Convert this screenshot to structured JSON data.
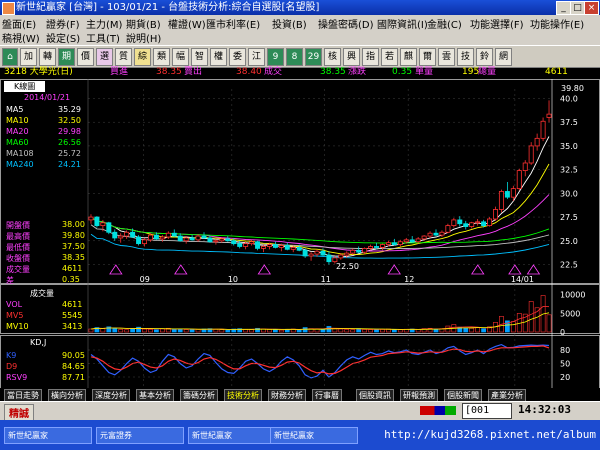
{
  "window": {
    "title": "新世紀贏家 [台灣] - 103/01/21 - 台盤技術分析:綜合自選股[名望股]",
    "min": "_",
    "max": "□",
    "close": "×"
  },
  "menu": {
    "row1": [
      "盤面(E)",
      "證券(F)",
      "主力(M)",
      "期貨(B)",
      "權證(W)",
      "匯市利率(E)",
      "投資(B)",
      "操盤密碼(D)",
      "國際資訊(I)",
      "金融(C)",
      "功能選擇(F)",
      "功能操作(E)"
    ],
    "row2": [
      "稿視(W)",
      "設定(S)",
      "工具(T)",
      "說明(H)"
    ]
  },
  "toolbar": {
    "buttons": [
      "加",
      "轉",
      "期",
      "價",
      "選",
      "質",
      "綜",
      "類",
      "幅",
      "智",
      "權",
      "委",
      "江",
      "9",
      "8",
      "29",
      "核",
      "興",
      "指",
      "若",
      "麒",
      "爾",
      "雲",
      "技",
      "鈴",
      "網"
    ]
  },
  "quote": {
    "symbol": "3218 大學光(日)",
    "bid_label": "買進",
    "bid": "38.35",
    "ask_label": "賣出",
    "ask": "38.40",
    "last_label": "成交",
    "last": "38.35",
    "change_label": "漲跌",
    "change": "0.35",
    "volume_label": "單量",
    "volume": "195",
    "total_label": "總量",
    "total": "4611"
  },
  "colors": {
    "up": "#ff3030",
    "down": "#00e0e0",
    "ma5": "#ffffff",
    "ma10": "#ffff00",
    "ma20": "#ff40ff",
    "ma60": "#00ff00",
    "ma108": "#c0c0c0",
    "ma240": "#00c0ff",
    "vol": "#00a0ff",
    "k9": "#3060ff",
    "d9": "#ff3030",
    "grid": "#404040"
  },
  "kpanel": {
    "label": "K線圖",
    "date": "2014/01/21",
    "legend": [
      {
        "name": "MA5",
        "value": "35.29",
        "color": "#ffffff"
      },
      {
        "name": "MA10",
        "value": "32.50",
        "color": "#ffff00"
      },
      {
        "name": "MA20",
        "value": "29.98",
        "color": "#ff40ff"
      },
      {
        "name": "MA60",
        "value": "26.56",
        "color": "#00ff00"
      },
      {
        "name": "MA108",
        "value": "25.72",
        "color": "#c0c0c0"
      },
      {
        "name": "MA240",
        "value": "24.21",
        "color": "#00c0ff"
      }
    ],
    "ohlc": [
      {
        "label": "開盤價",
        "value": "38.00"
      },
      {
        "label": "最高價",
        "value": "39.80"
      },
      {
        "label": "最低價",
        "value": "37.50"
      },
      {
        "label": "收盤價",
        "value": "38.35"
      },
      {
        "label": "成交量",
        "value": "4611"
      },
      {
        "label": "差",
        "value": "0.35"
      }
    ],
    "high_marker": "39.80",
    "low_marker": "22.50",
    "yticks": [
      "40.0",
      "37.5",
      "35.0",
      "32.5",
      "30.0",
      "27.5",
      "25.0",
      "22.5"
    ],
    "xticks": [
      "09",
      "10",
      "11",
      "12",
      "14/01"
    ]
  },
  "volpanel": {
    "label": "成交量",
    "legend": [
      {
        "name": "VOL",
        "value": "4611",
        "color": "#ff40ff"
      },
      {
        "name": "MV5",
        "value": "5545",
        "color": "#ff3030"
      },
      {
        "name": "MV10",
        "value": "3413",
        "color": "#ffff00"
      }
    ],
    "yticks": [
      "10000",
      "5000",
      "0"
    ]
  },
  "kdpanel": {
    "label": "KD,J",
    "legend": [
      {
        "name": "K9",
        "value": "90.05",
        "color": "#3060ff"
      },
      {
        "name": "D9",
        "value": "84.65",
        "color": "#ff3030"
      },
      {
        "name": "RSV9",
        "value": "87.71",
        "color": "#ff40ff"
      }
    ],
    "yticks": [
      "80",
      "50",
      "20"
    ]
  },
  "tabs": [
    "當日走勢",
    "橫向分析",
    "深度分析",
    "基本分析",
    "籌碼分析",
    "技術分析",
    "財務分析",
    "行事曆",
    "個股資訊",
    "研報預測",
    "個股新聞",
    "產業分析"
  ],
  "active_tab": "技術分析",
  "status": {
    "mode": "精誠",
    "input": "001",
    "time": "14:32:03"
  },
  "taskbar": {
    "tasks": [
      "新世紀贏家",
      "元富證券",
      "新世紀贏家",
      "新世紀贏家"
    ],
    "url": "http://kujd3268.pixnet.net/album"
  },
  "chart_data": {
    "type": "candlestick",
    "title": "3218 大學光(日)",
    "ylim": [
      21.5,
      41
    ],
    "xticks": [
      "09",
      "10",
      "11",
      "12",
      "14/01"
    ],
    "candles": [
      [
        27.2,
        27.8,
        26.8,
        27.5
      ],
      [
        27.5,
        27.6,
        26.4,
        26.6
      ],
      [
        26.6,
        27.2,
        26.0,
        26.9
      ],
      [
        26.9,
        27.0,
        25.7,
        25.9
      ],
      [
        25.9,
        26.2,
        25.0,
        25.3
      ],
      [
        25.3,
        25.8,
        24.8,
        25.5
      ],
      [
        25.5,
        26.1,
        25.2,
        25.9
      ],
      [
        25.9,
        26.3,
        25.3,
        25.4
      ],
      [
        25.4,
        25.6,
        24.5,
        24.7
      ],
      [
        24.7,
        25.3,
        24.4,
        25.1
      ],
      [
        25.1,
        25.8,
        24.9,
        25.6
      ],
      [
        25.6,
        25.9,
        25.1,
        25.2
      ],
      [
        25.2,
        25.6,
        24.9,
        25.4
      ],
      [
        25.4,
        26.0,
        25.2,
        25.8
      ],
      [
        25.8,
        26.2,
        25.4,
        25.5
      ],
      [
        25.5,
        25.8,
        24.9,
        25.0
      ],
      [
        25.0,
        25.5,
        24.7,
        25.3
      ],
      [
        25.3,
        25.6,
        25.0,
        25.1
      ],
      [
        25.1,
        25.7,
        24.9,
        25.5
      ],
      [
        25.5,
        25.9,
        25.2,
        25.3
      ],
      [
        25.3,
        25.5,
        24.8,
        24.9
      ],
      [
        24.9,
        25.2,
        24.6,
        25.0
      ],
      [
        25.0,
        25.4,
        24.8,
        25.2
      ],
      [
        25.2,
        25.5,
        24.9,
        25.0
      ],
      [
        25.0,
        25.3,
        24.5,
        24.7
      ],
      [
        24.7,
        25.0,
        24.2,
        24.4
      ],
      [
        24.4,
        24.9,
        24.1,
        24.7
      ],
      [
        24.7,
        25.1,
        24.5,
        24.9
      ],
      [
        24.9,
        25.0,
        24.0,
        24.2
      ],
      [
        24.2,
        24.6,
        23.8,
        24.4
      ],
      [
        24.4,
        24.8,
        24.1,
        24.6
      ],
      [
        24.6,
        24.9,
        24.2,
        24.3
      ],
      [
        24.3,
        24.7,
        23.9,
        24.5
      ],
      [
        24.5,
        24.8,
        24.0,
        24.1
      ],
      [
        24.1,
        24.5,
        23.8,
        24.3
      ],
      [
        24.3,
        24.6,
        23.9,
        24.0
      ],
      [
        24.0,
        24.2,
        23.2,
        23.4
      ],
      [
        23.4,
        23.8,
        22.9,
        23.6
      ],
      [
        23.6,
        24.1,
        23.3,
        23.9
      ],
      [
        23.9,
        24.2,
        23.4,
        23.5
      ],
      [
        23.5,
        23.9,
        22.5,
        22.8
      ],
      [
        22.8,
        23.4,
        22.6,
        23.2
      ],
      [
        23.2,
        23.7,
        23.0,
        23.5
      ],
      [
        23.5,
        23.9,
        23.2,
        23.7
      ],
      [
        23.7,
        24.2,
        23.5,
        24.0
      ],
      [
        24.0,
        24.4,
        23.7,
        23.8
      ],
      [
        23.8,
        24.3,
        23.6,
        24.2
      ],
      [
        24.2,
        24.6,
        24.0,
        24.4
      ],
      [
        24.4,
        24.8,
        24.1,
        24.3
      ],
      [
        24.3,
        24.7,
        24.0,
        24.6
      ],
      [
        24.6,
        25.0,
        24.4,
        24.8
      ],
      [
        24.8,
        25.2,
        24.5,
        24.6
      ],
      [
        24.6,
        25.1,
        24.4,
        24.9
      ],
      [
        24.9,
        25.3,
        24.7,
        25.1
      ],
      [
        25.1,
        25.5,
        24.8,
        24.9
      ],
      [
        24.9,
        25.4,
        24.7,
        25.2
      ],
      [
        25.2,
        25.6,
        25.0,
        25.5
      ],
      [
        25.5,
        26.0,
        25.3,
        25.8
      ],
      [
        25.8,
        26.2,
        25.5,
        25.6
      ],
      [
        25.6,
        26.1,
        25.4,
        25.9
      ],
      [
        25.9,
        26.8,
        25.8,
        26.6
      ],
      [
        26.6,
        27.4,
        26.4,
        27.2
      ],
      [
        27.2,
        27.6,
        26.5,
        26.8
      ],
      [
        26.8,
        27.1,
        26.2,
        26.5
      ],
      [
        26.5,
        27.0,
        26.3,
        26.9
      ],
      [
        26.9,
        27.3,
        26.6,
        27.0
      ],
      [
        27.0,
        27.2,
        26.4,
        26.6
      ],
      [
        26.6,
        27.5,
        26.5,
        27.3
      ],
      [
        27.3,
        28.6,
        27.1,
        28.3
      ],
      [
        28.3,
        30.4,
        28.0,
        30.2
      ],
      [
        30.2,
        31.2,
        29.4,
        29.6
      ],
      [
        29.6,
        30.8,
        29.2,
        30.5
      ],
      [
        30.5,
        32.6,
        30.3,
        32.4
      ],
      [
        32.4,
        33.5,
        31.8,
        33.2
      ],
      [
        33.2,
        35.4,
        33.0,
        35.0
      ],
      [
        35.0,
        36.3,
        34.5,
        35.8
      ],
      [
        35.8,
        38.0,
        35.5,
        37.6
      ],
      [
        38.0,
        39.8,
        37.5,
        38.35
      ]
    ],
    "volume": [
      800,
      1200,
      900,
      1400,
      1100,
      700,
      600,
      900,
      1300,
      800,
      700,
      600,
      900,
      1000,
      800,
      700,
      650,
      600,
      700,
      800,
      900,
      700,
      600,
      500,
      800,
      900,
      700,
      600,
      1000,
      800,
      700,
      600,
      500,
      700,
      800,
      600,
      1200,
      900,
      800,
      700,
      1500,
      1000,
      800,
      700,
      600,
      900,
      700,
      650,
      600,
      700,
      800,
      700,
      600,
      750,
      800,
      700,
      900,
      1000,
      800,
      900,
      1600,
      2000,
      1300,
      1100,
      1000,
      1200,
      900,
      1400,
      2600,
      4200,
      3000,
      2800,
      5000,
      4800,
      8200,
      6500,
      9800,
      4611
    ],
    "kd_k": [
      70,
      60,
      45,
      30,
      25,
      35,
      50,
      62,
      55,
      40,
      30,
      35,
      55,
      70,
      65,
      50,
      40,
      45,
      60,
      72,
      68,
      52,
      38,
      30,
      28,
      40,
      55,
      60,
      50,
      38,
      32,
      40,
      55,
      65,
      58,
      45,
      25,
      18,
      22,
      35,
      20,
      30,
      45,
      58,
      65,
      60,
      68,
      75,
      70,
      72,
      78,
      74,
      76,
      80,
      72,
      70,
      75,
      80,
      72,
      76,
      85,
      88,
      78,
      70,
      74,
      80,
      72,
      82,
      88,
      92,
      85,
      86,
      89,
      90,
      91,
      90,
      91,
      90.05
    ],
    "kd_d": [
      65,
      62,
      55,
      45,
      38,
      36,
      42,
      50,
      53,
      48,
      42,
      40,
      45,
      55,
      60,
      57,
      51,
      48,
      52,
      60,
      63,
      59,
      52,
      44,
      38,
      38,
      45,
      50,
      50,
      46,
      42,
      41,
      46,
      53,
      55,
      51,
      42,
      34,
      29,
      31,
      27,
      28,
      34,
      42,
      50,
      53,
      58,
      64,
      66,
      68,
      72,
      73,
      74,
      76,
      75,
      73,
      74,
      76,
      75,
      75,
      79,
      82,
      81,
      77,
      76,
      78,
      76,
      78,
      82,
      85,
      85,
      85,
      86,
      87,
      88,
      88,
      89,
      84.65
    ]
  }
}
